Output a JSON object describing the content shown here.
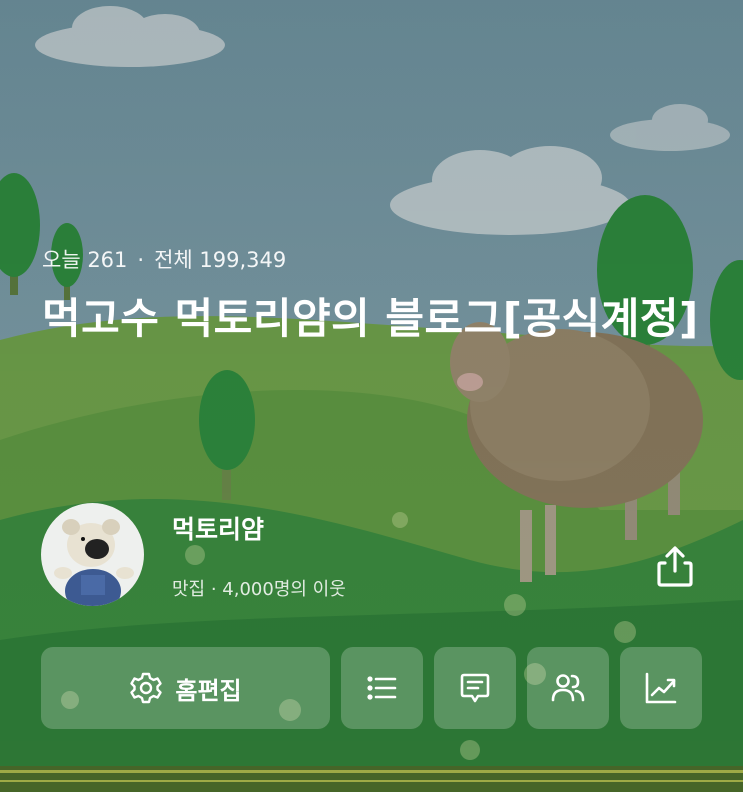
{
  "stats": {
    "today": "오늘 261",
    "total": "전체 199,349",
    "separator": "·"
  },
  "blog": {
    "title": "먹고수 먹토리얌의 블로그[공식계정]"
  },
  "profile": {
    "nickname": "먹토리얌",
    "meta": "맛집 · 4,000명의 이웃"
  },
  "buttons": {
    "edit_home": "홈편집"
  },
  "icons": {
    "share": "share-icon",
    "settings": "gear-icon",
    "list": "list-icon",
    "post": "post-icon",
    "neighbors": "people-icon",
    "stats": "trend-chart-icon"
  },
  "colors": {
    "sky": "#7a9aa6",
    "hill_light": "#5f9843",
    "hill_dark": "#2f7a3c",
    "tree": "#2f8a3f",
    "button_bg": "rgba(255,255,255,0.22)"
  }
}
